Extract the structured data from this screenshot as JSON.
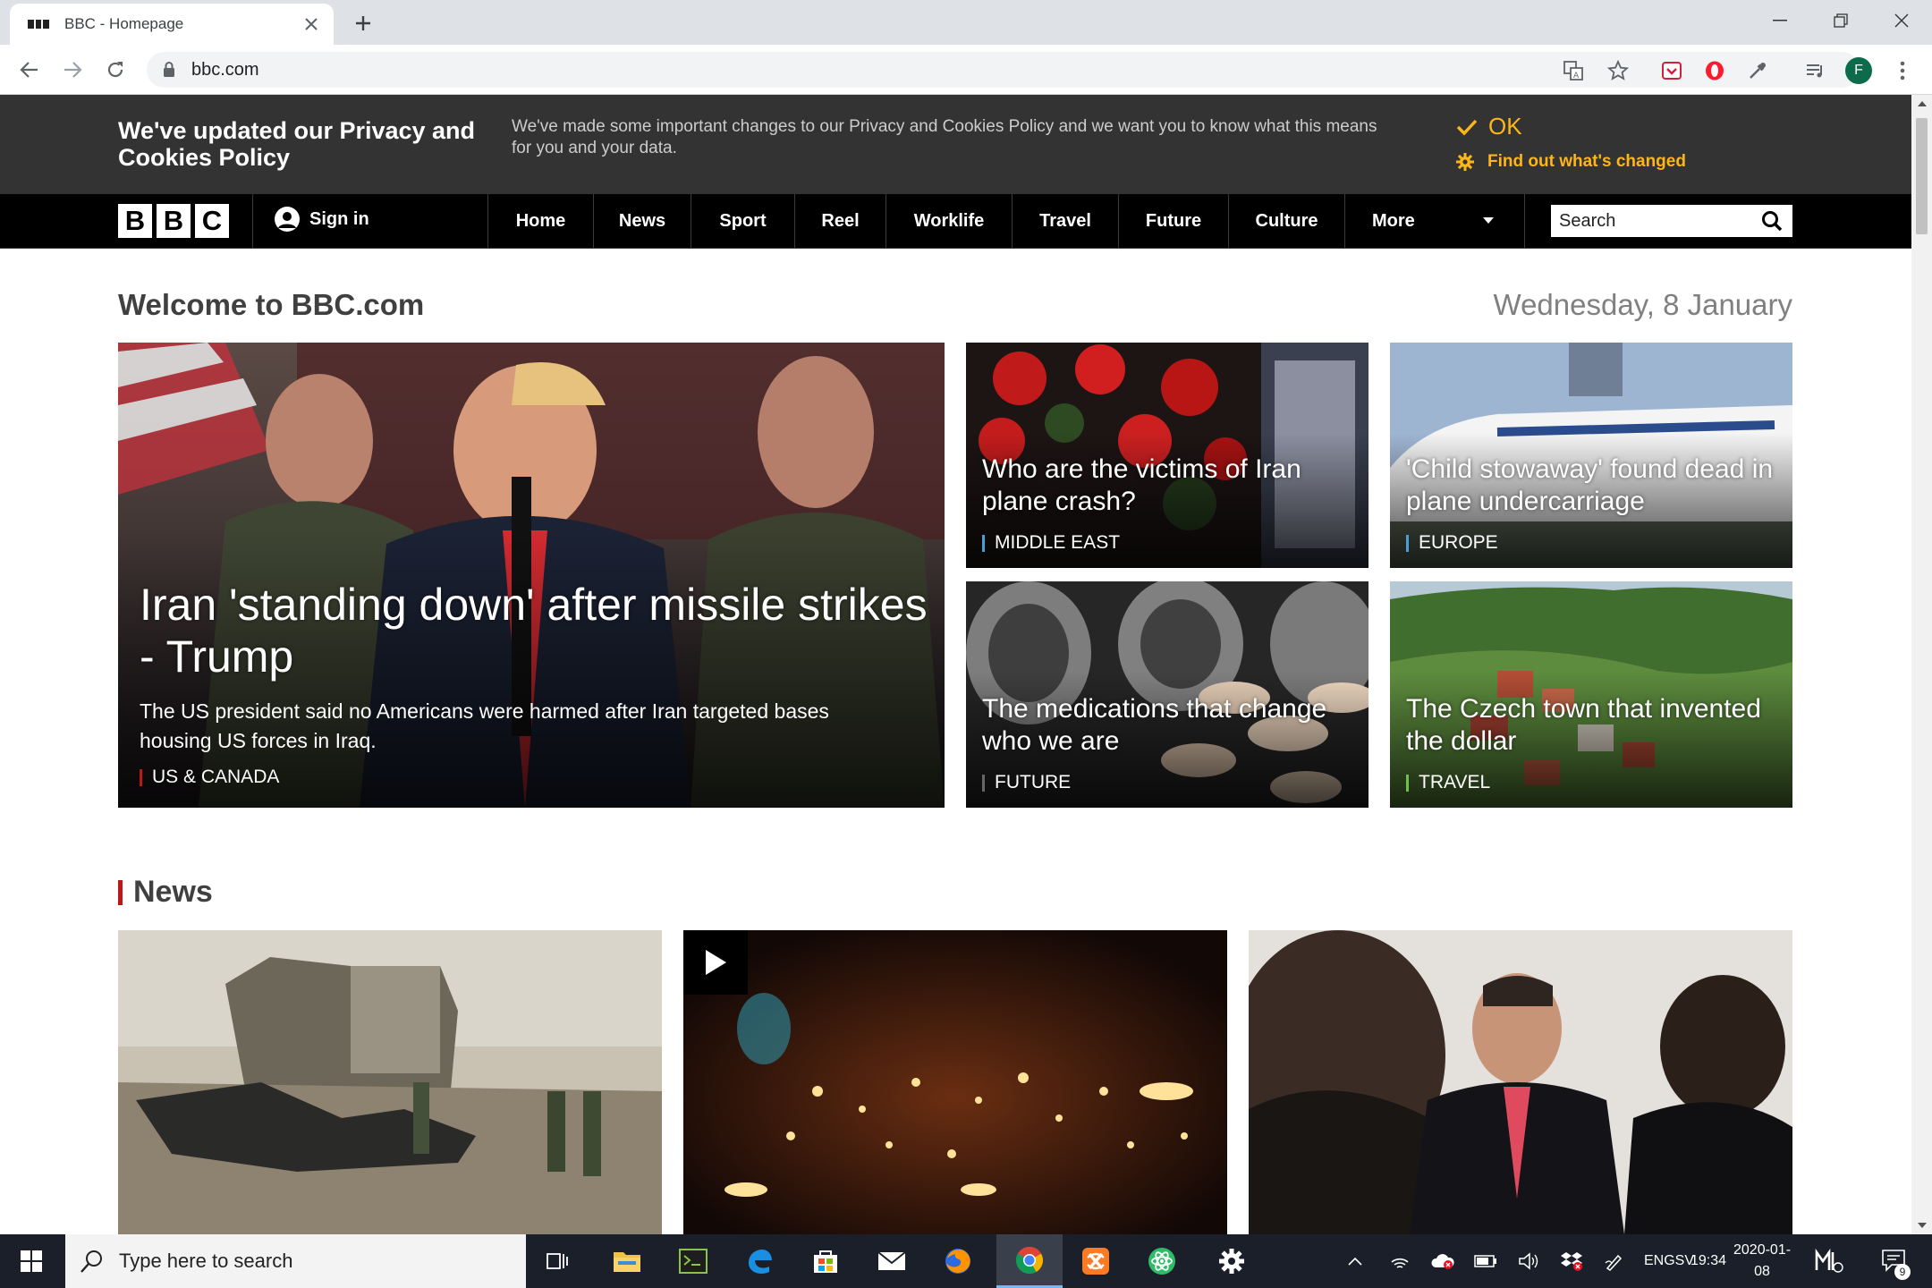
{
  "browser": {
    "tab_title": "BBC - Homepage",
    "url": "bbc.com",
    "profile_initial": "F"
  },
  "privacy_banner": {
    "title": "We've updated our Privacy and Cookies Policy",
    "body": "We've made some important changes to our Privacy and Cookies Policy and we want you to know what this means for you and your data.",
    "ok_label": "OK",
    "changed_label": "Find out what's changed",
    "accent": "#fcb61a"
  },
  "nav": {
    "logo": [
      "B",
      "B",
      "C"
    ],
    "sign_in": "Sign in",
    "items": [
      "Home",
      "News",
      "Sport",
      "Reel",
      "Worklife",
      "Travel",
      "Future",
      "Culture",
      "More"
    ],
    "search_placeholder": "Search"
  },
  "welcome": {
    "title": "Welcome to BBC.com",
    "date": "Wednesday, 8 January"
  },
  "promos": {
    "main": {
      "title": "Iran 'standing down' after missile strikes - Trump",
      "summary": "The US president said no Americans were harmed after Iran targeted bases housing US forces in Iraq.",
      "tag": "US & CANADA",
      "tag_color": "#bb1919"
    },
    "items": [
      {
        "title": "Who are the victims of Iran plane crash?",
        "tag": "MIDDLE EAST",
        "tag_color": "#4a9ed8"
      },
      {
        "title": "'Child stowaway' found dead in plane undercarriage",
        "tag": "EUROPE",
        "tag_color": "#4a9ed8"
      },
      {
        "title": "The medications that change who we are",
        "tag": "FUTURE",
        "tag_color": "#666666"
      },
      {
        "title": "The Czech town that invented the dollar",
        "tag": "TRAVEL",
        "tag_color": "#6fbf4a"
      }
    ]
  },
  "news_section": {
    "title": "News",
    "accent": "#bb1919"
  },
  "taskbar": {
    "search_placeholder": "Type here to search",
    "lang_top": "ENG",
    "lang_bottom": "SV",
    "time": "19:34",
    "date": "2020-01-08",
    "notification_count": "9"
  }
}
